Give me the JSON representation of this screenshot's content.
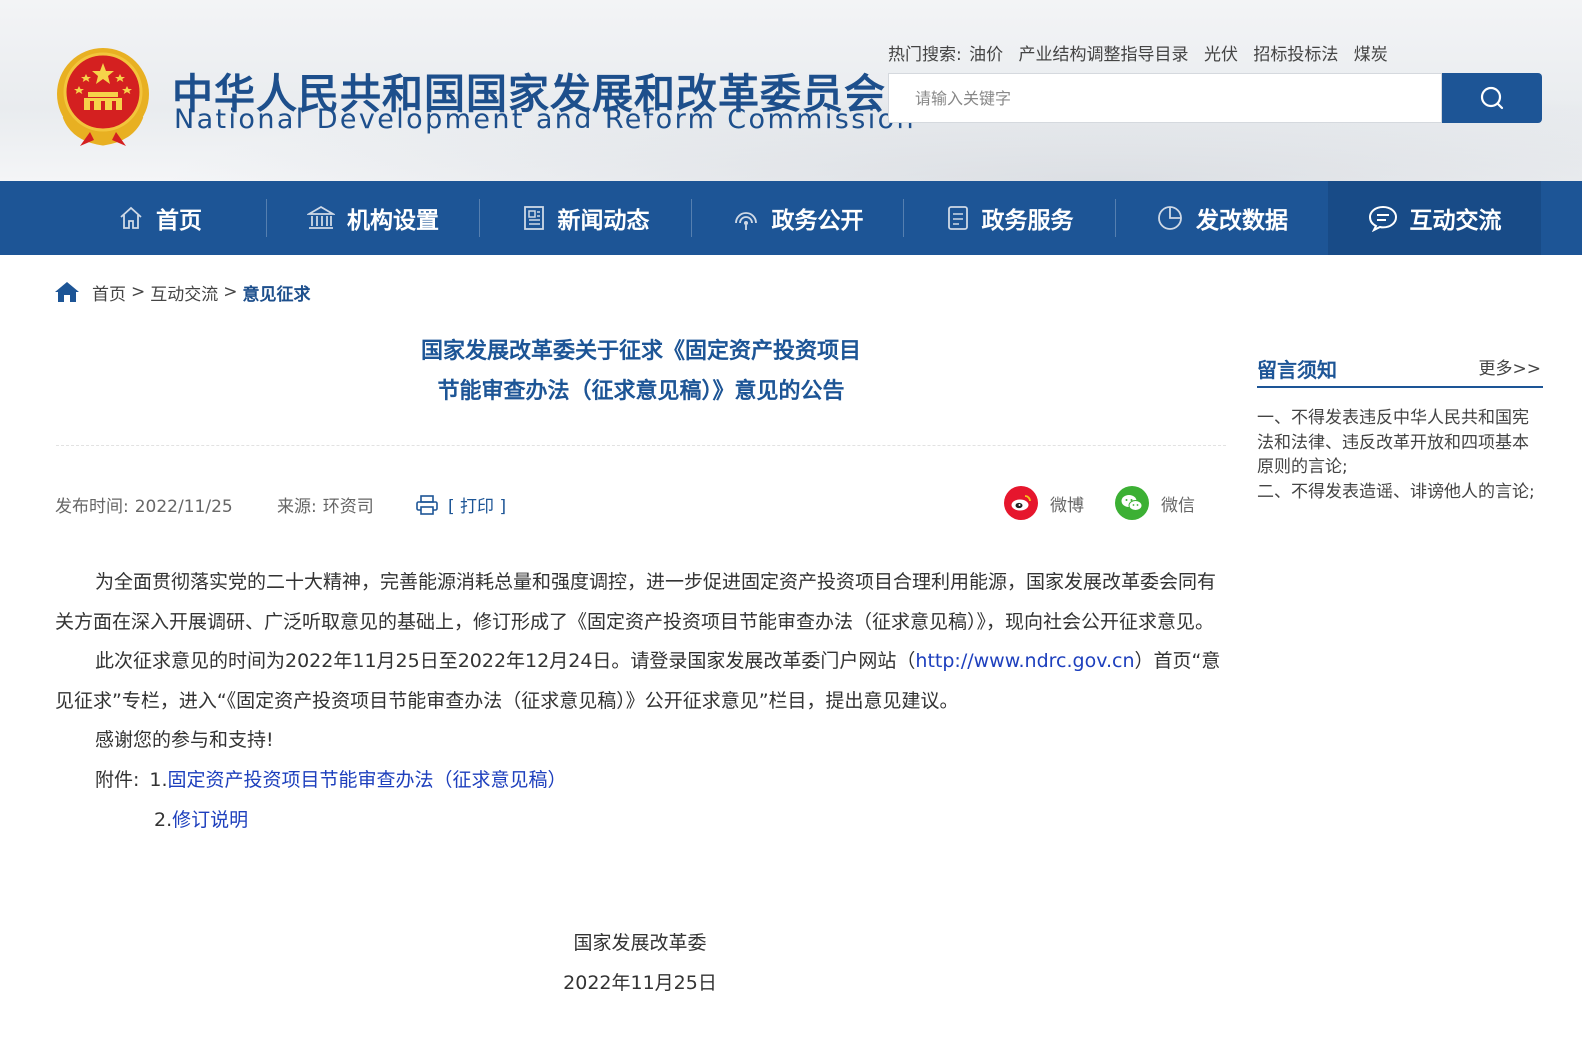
{
  "header": {
    "title_cn": "中华人民共和国国家发展和改革委员会",
    "title_en": "National Development and Reform Commission",
    "hot_search_label": "热门搜索:",
    "hot_search_terms": [
      "油价",
      "产业结构调整指导目录",
      "光伏",
      "招标投标法",
      "煤炭"
    ],
    "search_placeholder": "请输入关键字",
    "emblem_icon": "national-emblem",
    "search_icon": "search-icon"
  },
  "nav": {
    "items": [
      {
        "label": "首页",
        "icon": "home-icon"
      },
      {
        "label": "机构设置",
        "icon": "building-icon"
      },
      {
        "label": "新闻动态",
        "icon": "newspaper-icon"
      },
      {
        "label": "政务公开",
        "icon": "broadcast-icon"
      },
      {
        "label": "政务服务",
        "icon": "document-icon"
      },
      {
        "label": "发改数据",
        "icon": "pie-chart-icon"
      },
      {
        "label": "互动交流",
        "icon": "chat-icon"
      }
    ],
    "active_index": 6
  },
  "breadcrumb": {
    "items": [
      "首页",
      "互动交流",
      "意见征求"
    ],
    "separator": ">"
  },
  "article": {
    "title_line1": "国家发展改革委关于征求《固定资产投资项目",
    "title_line2": "节能审查办法（征求意见稿）》意见的公告",
    "publish_label": "发布时间:",
    "publish_date": "2022/11/25",
    "source_label": "来源:",
    "source_value": "环资司",
    "print_label": "[ 打印 ]",
    "share": [
      {
        "label": "微博",
        "icon": "weibo-icon",
        "color": "#e6162d"
      },
      {
        "label": "微信",
        "icon": "wechat-icon",
        "color": "#3cb034"
      }
    ],
    "para1": "为全面贯彻落实党的二十大精神，完善能源消耗总量和强度调控，进一步促进固定资产投资项目合理利用能源，国家发展改革委会同有关方面在深入开展调研、广泛听取意见的基础上，修订形成了《固定资产投资项目节能审查办法（征求意见稿）》，现向社会公开征求意见。",
    "para2_before": "此次征求意见的时间为2022年11月25日至2022年12月24日。请登录国家发展改革委门户网站（",
    "para2_link": "http://www.ndrc.gov.cn",
    "para2_after": "）首页“意见征求”专栏，进入“《固定资产投资项目节能审查办法（征求意见稿）》公开征求意见”栏目，提出意见建议。",
    "para3": "感谢您的参与和支持!",
    "attach_label": "附件:",
    "attach1_num": "1.",
    "attach1_link": "固定资产投资项目节能审查办法（征求意见稿）",
    "attach2_num": "2.",
    "attach2_link": "修订说明",
    "signature_org": "国家发展改革委",
    "signature_date": "2022年11月25日"
  },
  "sidebar": {
    "title": "留言须知",
    "more": "更多>>",
    "rule1": "一、不得发表违反中华人民共和国宪法和法律、违反改革开放和四项基本原则的言论;",
    "rule2": "二、不得发表造谣、诽谤他人的言论;"
  },
  "colors": {
    "brand_blue": "#1d5596",
    "title_blue": "#1d4f8c",
    "link_blue": "#1d3fbd"
  }
}
